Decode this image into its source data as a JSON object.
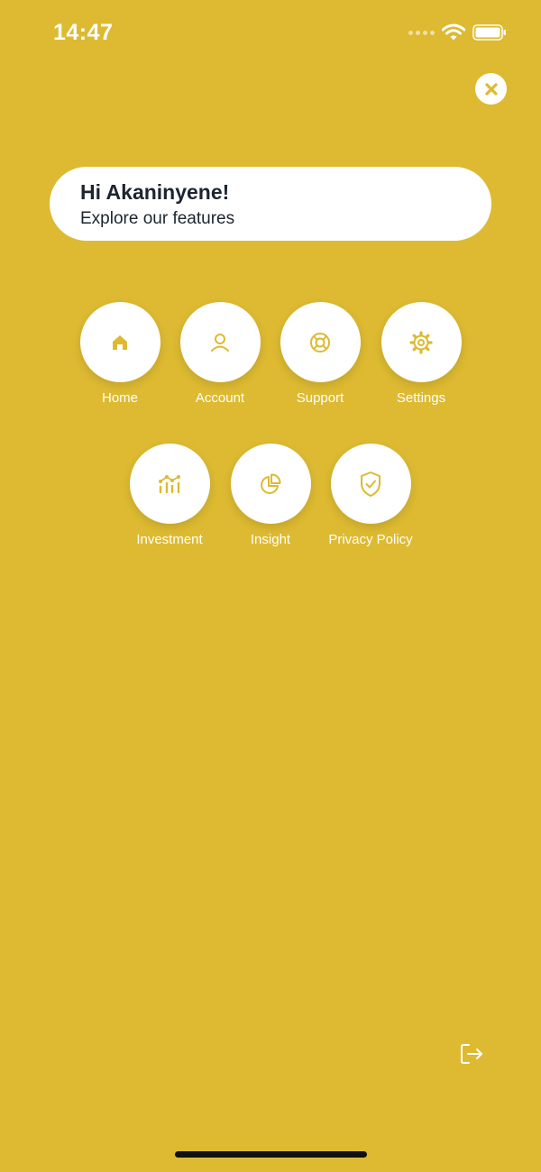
{
  "status_bar": {
    "time": "14:47"
  },
  "greeting": {
    "title": "Hi Akaninyene!",
    "subtitle": "Explore our features"
  },
  "menu": {
    "home": "Home",
    "account": "Account",
    "support": "Support",
    "settings": "Settings",
    "investment": "Investment",
    "insight": "Insight",
    "privacy": "Privacy Policy"
  },
  "icons": {
    "close": "close-icon",
    "home": "home-icon",
    "account": "user-icon",
    "support": "lifebuoy-icon",
    "settings": "gear-icon",
    "investment": "chart-icon",
    "insight": "pie-chart-icon",
    "privacy": "shield-check-icon",
    "logout": "logout-icon"
  },
  "colors": {
    "background": "#DDBA31",
    "accent": "#DDBA31",
    "text_dark": "#1c2530"
  }
}
